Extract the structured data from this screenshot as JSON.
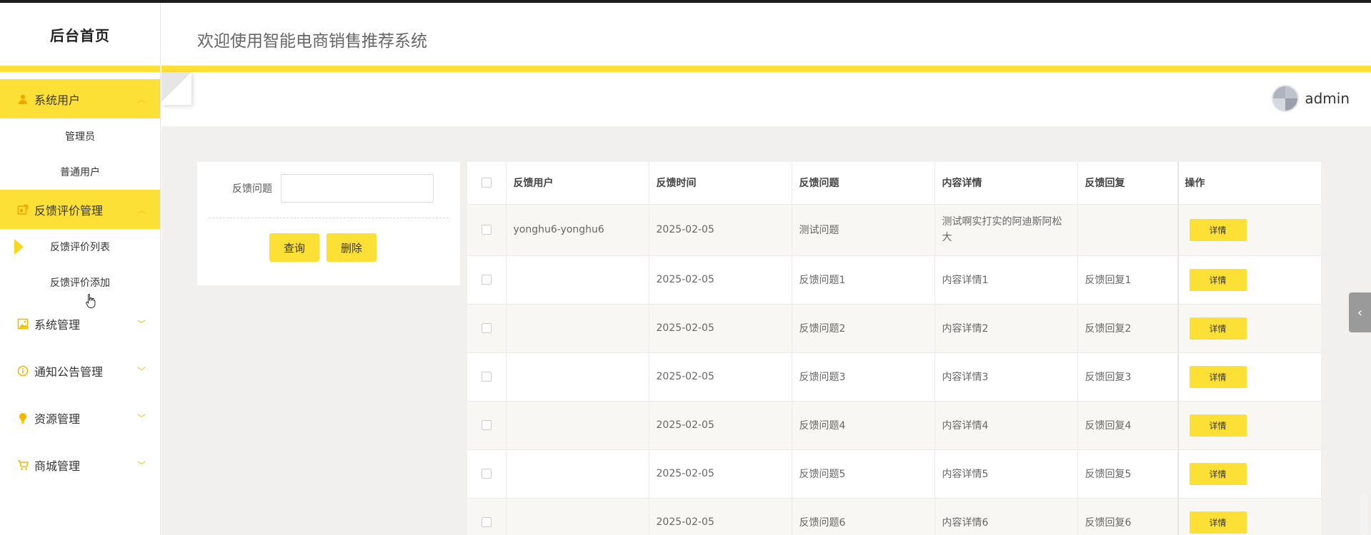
{
  "sidebar": {
    "brand": "后台首页",
    "groups": [
      {
        "label": "系统用户",
        "icon": "user-icon",
        "expanded": true,
        "items": [
          "管理员",
          "普通用户"
        ]
      },
      {
        "label": "反馈评价管理",
        "icon": "feedback-icon",
        "expanded": true,
        "items": [
          "反馈评价列表",
          "反馈评价添加"
        ],
        "active_item": "反馈评价列表"
      },
      {
        "label": "系统管理",
        "icon": "picture-icon",
        "expanded": false
      },
      {
        "label": "通知公告管理",
        "icon": "info-icon",
        "expanded": false
      },
      {
        "label": "资源管理",
        "icon": "bulb-icon",
        "expanded": false
      },
      {
        "label": "商城管理",
        "icon": "cart-icon",
        "expanded": false
      }
    ]
  },
  "header": {
    "title": "欢迎使用智能电商销售推荐系统",
    "username": "admin"
  },
  "search": {
    "label": "反馈问题",
    "value": "",
    "query_button": "查询",
    "delete_button": "删除"
  },
  "table": {
    "columns": [
      "反馈用户",
      "反馈时间",
      "反馈问题",
      "内容详情",
      "反馈回复",
      "操作"
    ],
    "rows": [
      {
        "user": "yonghu6-yonghu6",
        "time": "2025-02-05",
        "question": "测试问题",
        "detail": "测试啊实打实的阿迪斯阿松大",
        "reply": "",
        "action": "详情"
      },
      {
        "user": "",
        "time": "2025-02-05",
        "question": "反馈问题1",
        "detail": "内容详情1",
        "reply": "反馈回复1",
        "action": "详情"
      },
      {
        "user": "",
        "time": "2025-02-05",
        "question": "反馈问题2",
        "detail": "内容详情2",
        "reply": "反馈回复2",
        "action": "详情"
      },
      {
        "user": "",
        "time": "2025-02-05",
        "question": "反馈问题3",
        "detail": "内容详情3",
        "reply": "反馈回复3",
        "action": "详情"
      },
      {
        "user": "",
        "time": "2025-02-05",
        "question": "反馈问题4",
        "detail": "内容详情4",
        "reply": "反馈回复4",
        "action": "详情"
      },
      {
        "user": "",
        "time": "2025-02-05",
        "question": "反馈问题5",
        "detail": "内容详情5",
        "reply": "反馈回复5",
        "action": "详情"
      },
      {
        "user": "",
        "time": "2025-02-05",
        "question": "反馈问题6",
        "detail": "内容详情6",
        "reply": "反馈回复6",
        "action": "详情"
      }
    ]
  },
  "colors": {
    "accent": "#fde035",
    "content_bg": "#f1f0ef"
  }
}
